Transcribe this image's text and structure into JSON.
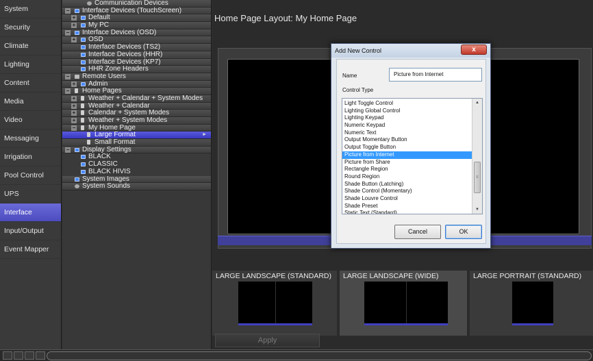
{
  "nav": {
    "items": [
      {
        "label": "System",
        "active": false
      },
      {
        "label": "Security",
        "active": false
      },
      {
        "label": "Climate",
        "active": false
      },
      {
        "label": "Lighting",
        "active": false
      },
      {
        "label": "Content",
        "active": false
      },
      {
        "label": "Media",
        "active": false
      },
      {
        "label": "Video",
        "active": false
      },
      {
        "label": "Messaging",
        "active": false
      },
      {
        "label": "Irrigation",
        "active": false
      },
      {
        "label": "Pool Control",
        "active": false
      },
      {
        "label": "UPS",
        "active": false
      },
      {
        "label": "Interface",
        "active": true
      },
      {
        "label": "Input/Output",
        "active": false
      },
      {
        "label": "Event Mapper",
        "active": false
      }
    ]
  },
  "tree": {
    "rows": [
      {
        "label": "Communication Devices",
        "level": 2,
        "expander": "",
        "icon": "gear-icon"
      },
      {
        "label": "Interface Devices (TouchScreen)",
        "level": 0,
        "expander": "−",
        "icon": "monitor-icon"
      },
      {
        "label": "Default",
        "level": 1,
        "expander": "+",
        "icon": "monitor-icon"
      },
      {
        "label": "My PC",
        "level": 1,
        "expander": "+",
        "icon": "monitor-icon"
      },
      {
        "label": "Interface Devices (OSD)",
        "level": 0,
        "expander": "−",
        "icon": "monitor-icon"
      },
      {
        "label": "OSD",
        "level": 1,
        "expander": "+",
        "icon": "monitor-icon"
      },
      {
        "label": "Interface Devices (TS2)",
        "level": 1,
        "expander": "",
        "icon": "monitor-icon"
      },
      {
        "label": "Interface Devices (HHR)",
        "level": 1,
        "expander": "",
        "icon": "monitor-icon"
      },
      {
        "label": "Interface Devices (KP7)",
        "level": 1,
        "expander": "",
        "icon": "monitor-icon"
      },
      {
        "label": "HHR Zone Headers",
        "level": 1,
        "expander": "",
        "icon": "header-icon"
      },
      {
        "label": "Remote Users",
        "level": 0,
        "expander": "−",
        "icon": "user-icon"
      },
      {
        "label": "Admin",
        "level": 1,
        "expander": "+",
        "icon": "monitor-icon"
      },
      {
        "label": "Home Pages",
        "level": 0,
        "expander": "−",
        "icon": "page-icon"
      },
      {
        "label": "Weather + Calendar + System Modes",
        "level": 1,
        "expander": "+",
        "icon": "page-icon"
      },
      {
        "label": "Weather + Calendar",
        "level": 1,
        "expander": "+",
        "icon": "page-icon"
      },
      {
        "label": "Calendar + System Modes",
        "level": 1,
        "expander": "+",
        "icon": "page-icon"
      },
      {
        "label": "Weather + System Modes",
        "level": 1,
        "expander": "+",
        "icon": "page-icon"
      },
      {
        "label": "My Home Page",
        "level": 1,
        "expander": "−",
        "icon": "page-icon"
      },
      {
        "label": "Large Format",
        "level": 2,
        "expander": "",
        "icon": "page-icon",
        "selected": true
      },
      {
        "label": "Small Format",
        "level": 2,
        "expander": "",
        "icon": "page-icon"
      },
      {
        "label": "Display Settings",
        "level": 0,
        "expander": "−",
        "icon": "display-icon"
      },
      {
        "label": "BLACK",
        "level": 1,
        "expander": "",
        "icon": "display-icon",
        "plain": true
      },
      {
        "label": "CLASSIC",
        "level": 1,
        "expander": "",
        "icon": "display-icon",
        "plain": true
      },
      {
        "label": "BLACK HIVIS",
        "level": 1,
        "expander": "",
        "icon": "display-icon",
        "plain": true
      },
      {
        "label": "System Images",
        "level": 0,
        "expander": "",
        "icon": "image-icon"
      },
      {
        "label": "System Sounds",
        "level": 0,
        "expander": "",
        "icon": "sound-icon"
      }
    ]
  },
  "main": {
    "title": "Home Page Layout: My Home Page",
    "formats": [
      {
        "label": "LARGE LANDSCAPE (STANDARD)",
        "selected": false
      },
      {
        "label": "LARGE LANDSCAPE (WIDE)",
        "selected": true
      },
      {
        "label": "LARGE PORTRAIT (STANDARD)",
        "selected": false
      }
    ],
    "apply_label": "Apply"
  },
  "dialog": {
    "title": "Add New Control",
    "close_label": "x",
    "name_label": "Name",
    "name_value": "Picture from Internet",
    "type_label": "Control Type",
    "items": [
      "Light Toggle Control",
      "Lighting Global Control",
      "Lighting Keypad",
      "Numeric Keypad",
      "Numeric Text",
      "Output Momentary Button",
      "Output Toggle Button",
      "Picture from Internet",
      "Picture from Share",
      "Rectangle Region",
      "Round Region",
      "Shade Button (Latching)",
      "Shade Control (Momentary)",
      "Shade Louvre Control",
      "Shade Preset",
      "Static Text (Standard)"
    ],
    "selected_item": "Picture from Internet",
    "cancel_label": "Cancel",
    "ok_label": "OK"
  },
  "colors": {
    "accent": "#4c4cc0",
    "selection": "#3399ff"
  }
}
